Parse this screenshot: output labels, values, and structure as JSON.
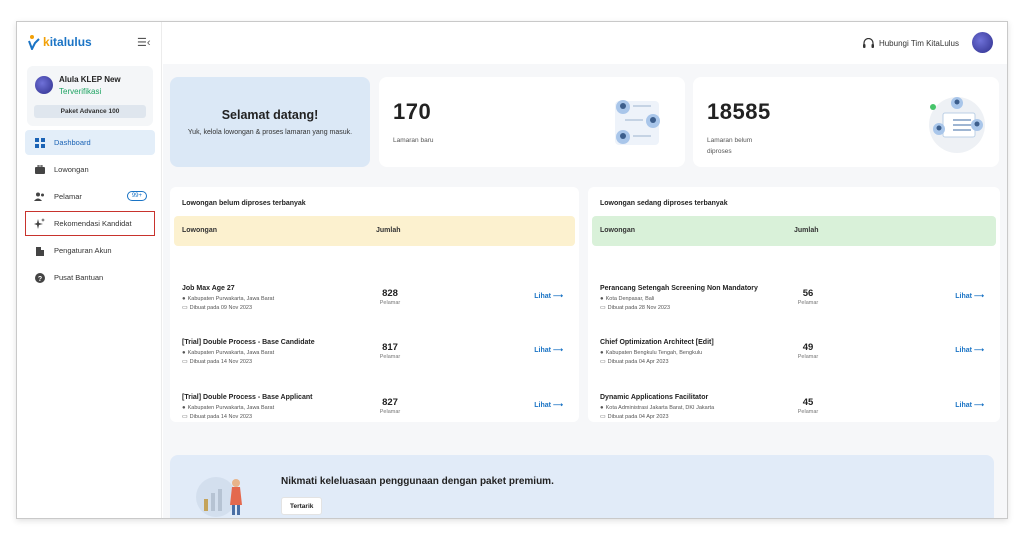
{
  "brand": {
    "name_k": "k",
    "name_rest": "italulus"
  },
  "profile": {
    "name": "Alula KLEP New",
    "status": "Terverifikasi",
    "package": "Paket Advance 100"
  },
  "nav": [
    {
      "label": "Dashboard",
      "icon": "dashboard-icon"
    },
    {
      "label": "Lowongan",
      "icon": "briefcase-icon"
    },
    {
      "label": "Pelamar",
      "icon": "people-icon",
      "badge": "99+"
    },
    {
      "label": "Rekomendasi Kandidat",
      "icon": "sparkle-icon"
    },
    {
      "label": "Pengaturan Akun",
      "icon": "building-icon"
    },
    {
      "label": "Pusat Bantuan",
      "icon": "help-icon"
    }
  ],
  "topbar": {
    "contact": "Hubungi Tim KitaLulus"
  },
  "welcome": {
    "title": "Selamat datang!",
    "subtitle": "Yuk, kelola lowongan & proses lamaran yang masuk."
  },
  "stats": [
    {
      "value": "170",
      "label": "Lamaran baru"
    },
    {
      "value": "18585",
      "label": "Lamaran belum diproses"
    }
  ],
  "table_left": {
    "title": "Lowongan belum diproses terbanyak",
    "col1": "Lowongan",
    "col2": "Jumlah",
    "rows": [
      {
        "title": "Job Max Age 27",
        "location": "Kabupaten Purwakarta, Jawa Barat",
        "date": "Dibuat pada 09 Nov 2023",
        "count": "828",
        "unit": "Pelamar",
        "action": "Lihat"
      },
      {
        "title": "[Trial] Double Process - Base Candidate",
        "location": "Kabupaten Purwakarta, Jawa Barat",
        "date": "Dibuat pada 14 Nov 2023",
        "count": "817",
        "unit": "Pelamar",
        "action": "Lihat"
      },
      {
        "title": "[Trial] Double Process - Base Applicant",
        "location": "Kabupaten Purwakarta, Jawa Barat",
        "date": "Dibuat pada 14 Nov 2023",
        "count": "827",
        "unit": "Pelamar",
        "action": "Lihat"
      }
    ]
  },
  "table_right": {
    "title": "Lowongan sedang diproses terbanyak",
    "col1": "Lowongan",
    "col2": "Jumlah",
    "rows": [
      {
        "title": "Perancang Setengah Screening Non Mandatory",
        "location": "Kota Denpasar, Bali",
        "date": "Dibuat pada 28 Nov 2023",
        "count": "56",
        "unit": "Pelamar",
        "action": "Lihat"
      },
      {
        "title": "Chief Optimization Architect [Edit]",
        "location": "Kabupaten Bengkulu Tengah, Bengkulu",
        "date": "Dibuat pada 04 Apr 2023",
        "count": "49",
        "unit": "Pelamar",
        "action": "Lihat"
      },
      {
        "title": "Dynamic Applications Facilitator",
        "location": "Kota Administrasi Jakarta Barat, DKI Jakarta",
        "date": "Dibuat pada 04 Apr 2023",
        "count": "45",
        "unit": "Pelamar",
        "action": "Lihat"
      }
    ]
  },
  "promo": {
    "title": "Nikmati keleluasaan penggunaan dengan paket premium.",
    "button": "Tertarik"
  },
  "colors": {
    "accent": "#1b74c5",
    "header_left": "#fcf1cf",
    "header_right": "#d9f1d9",
    "promo": "#e1ebf8"
  }
}
